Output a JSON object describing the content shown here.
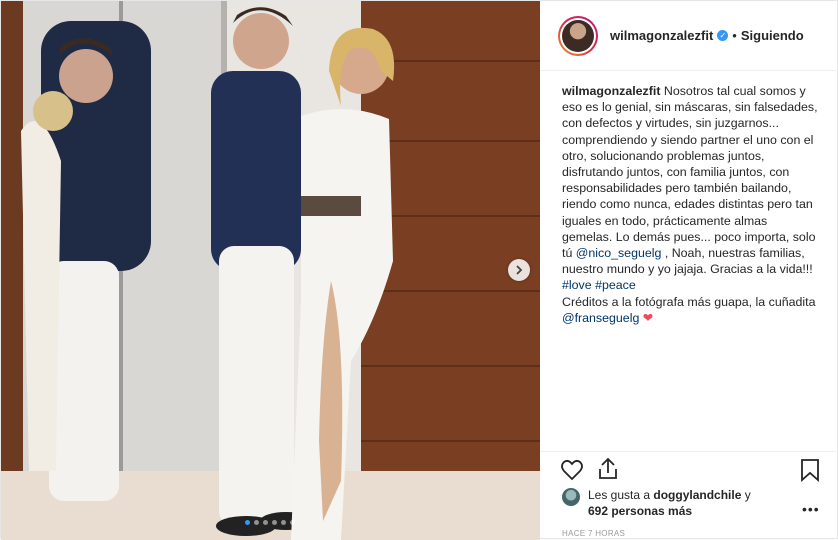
{
  "header": {
    "username": "wilmagonzalezfit",
    "separator": "•",
    "follow_status": "Siguiendo"
  },
  "caption": {
    "username": "wilmagonzalezfit",
    "text_1": " Nosotros tal cual somos y eso es lo genial, sin máscaras, sin falsedades, con defectos y virtudes, sin juzgarnos... comprendiendo y siendo partner el uno con el otro, solucionando problemas juntos, disfrutando juntos, con familia juntos, con responsabilidades pero también bailando, riendo como nunca, edades distintas pero tan iguales en todo, prácticamente almas gemelas. Lo demás pues... poco importa, solo tú ",
    "mention_1": "@nico_seguelg",
    "text_2": " , Noah, nuestras familias, nuestro mundo y yo jajaja. Gracias a la vida!!!",
    "hashtag_1": "#love",
    "hashtag_2": "#peace",
    "text_3": "Créditos a la fotógrafa más guapa, la cuñadita",
    "mention_2": "@franseguelg",
    "emoji": "❤"
  },
  "likes": {
    "prefix": "Les gusta a ",
    "user": "doggylandchile",
    "conj": " y",
    "count": "692 personas más"
  },
  "timestamp": "HACE 7 HORAS",
  "more_glyph": "•••",
  "icons": {
    "like": "heart-icon",
    "share": "share-icon",
    "save": "bookmark-icon",
    "next": "chevron-right-icon"
  },
  "colors": {
    "accent": "#3897f0",
    "link": "#003569",
    "heart": "#ed4956"
  }
}
